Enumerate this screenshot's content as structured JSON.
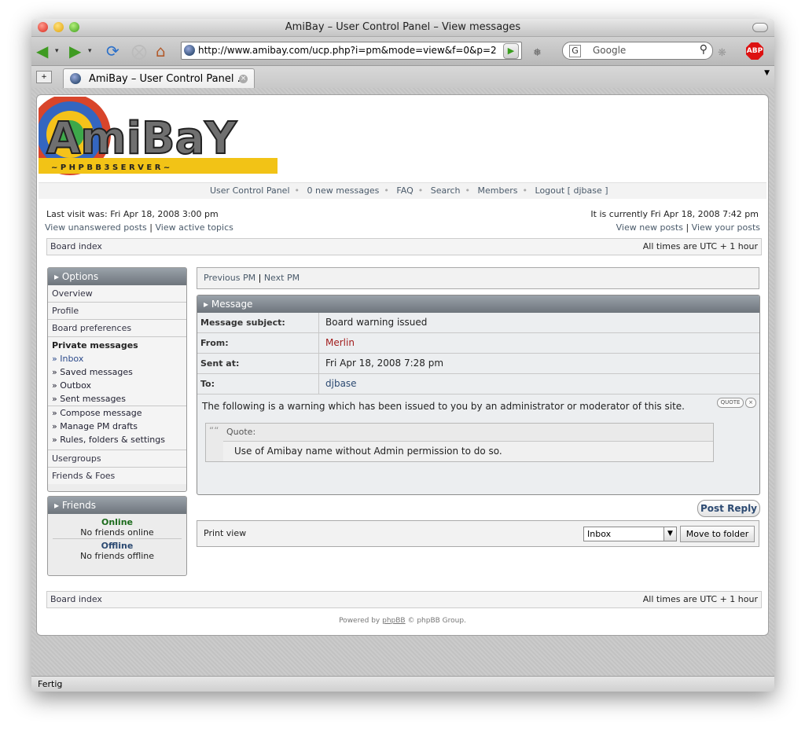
{
  "window": {
    "title": "AmiBay – User Control Panel – View messages"
  },
  "toolbar": {
    "url": "http://www.amibay.com/ucp.php?i=pm&mode=view&f=0&p=2",
    "search_engine_glyph": "G",
    "search_placeholder": "Google",
    "adblock_label": "ABP"
  },
  "tabs": [
    {
      "label": "AmiBay – User Control Panel ..."
    }
  ],
  "site": {
    "logo_text": "AmiBaY",
    "logo_subtext": "~ P H P B B 3   S E R V E R ~",
    "nav": [
      "User Control Panel",
      "0 new messages",
      "FAQ",
      "Search",
      "Members",
      "Logout [ djbase ]"
    ],
    "last_visit": "Last visit was: Fri Apr 18, 2008 3:00 pm",
    "current_time": "It is currently Fri Apr 18, 2008 7:42 pm",
    "unanswered": "View unanswered posts",
    "active_topics": "View active topics",
    "new_posts": "View new posts",
    "your_posts": "View your posts",
    "separator": "|",
    "board_index": "Board index",
    "timezone": "All times are UTC + 1 hour"
  },
  "sidebar": {
    "options_title": "Options",
    "items": [
      "Overview",
      "Profile",
      "Board preferences"
    ],
    "pm_title": "Private messages",
    "pm_items": [
      "» Inbox",
      "» Saved messages",
      "» Outbox",
      "» Sent messages",
      "» Compose message",
      "» Manage PM drafts",
      "» Rules, folders & settings"
    ],
    "bottom_items": [
      "Usergroups",
      "Friends & Foes"
    ],
    "friends_title": "Friends",
    "online_label": "Online",
    "online_text": "No friends online",
    "offline_label": "Offline",
    "offline_text": "No friends offline"
  },
  "pm_nav": {
    "prev": "Previous PM",
    "sep": "|",
    "next": "Next PM"
  },
  "message": {
    "header": "Message",
    "subject_label": "Message subject:",
    "subject": "Board warning issued",
    "from_label": "From:",
    "from": "Merlin",
    "sent_label": "Sent at:",
    "sent": "Fri Apr 18, 2008 7:28 pm",
    "to_label": "To:",
    "to": "djbase",
    "body": "The following is a warning which has been issued to you by an administrator or moderator of this site.",
    "quote_label": "Quote:",
    "quote_text": "Use of Amibay name without Admin permission to do so.",
    "quote_button": "QUOTE",
    "close_button": "×",
    "quote_mark": "““"
  },
  "actions": {
    "post_reply": "Post Reply",
    "print_view": "Print view",
    "folder_selected": "Inbox",
    "move_button": "Move to folder"
  },
  "footer": {
    "powered_prefix": "Powered by ",
    "phpbb": "phpBB",
    "powered_suffix": " © phpBB Group."
  },
  "status": {
    "text": "Fertig"
  },
  "colors": {
    "from_user": "#a11d1d",
    "to_user": "#2c4a72",
    "online": "#1b6b1b",
    "offline": "#2c4a72"
  }
}
